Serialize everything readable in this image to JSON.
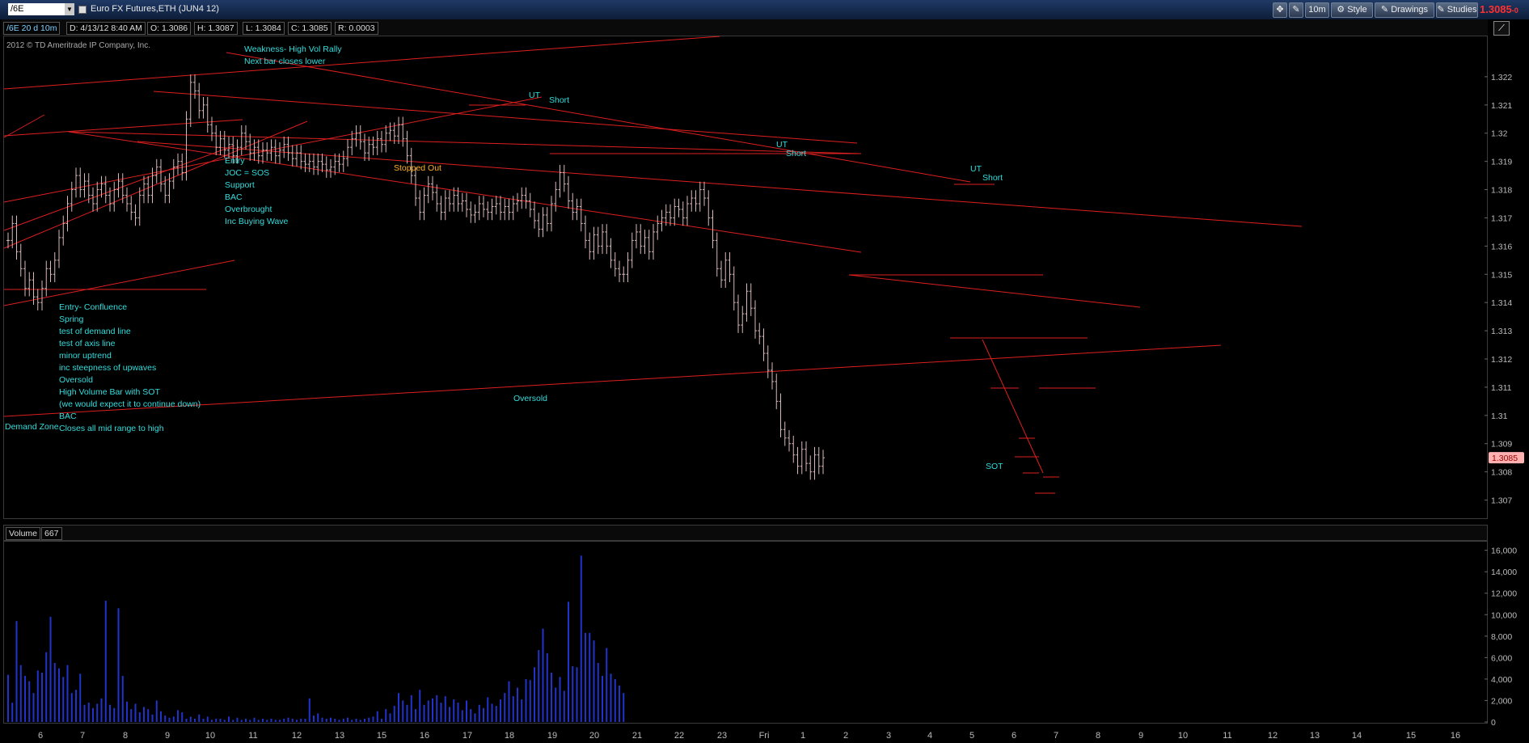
{
  "toolbar": {
    "symbol": "/6E",
    "instrument": "Euro FX Futures,ETH (JUN4 12)",
    "timeframe": "10m",
    "style_label": "Style",
    "drawings_label": "Drawings",
    "studies_label": "Studies",
    "last_price": "1.3085",
    "last_change": "-0"
  },
  "infobar": {
    "period": "/6E 20 d 10m",
    "date": "D: 4/13/12 8:40 AM",
    "open": "O: 1.3086",
    "high": "H: 1.3087",
    "low": "L: 1.3084",
    "close": "C: 1.3085",
    "range": "R: 0.0003",
    "copyright": "2012 © TD Ameritrade IP Company, Inc."
  },
  "volume_panel": {
    "label": "Volume",
    "value": "667"
  },
  "colors": {
    "background": "#000000",
    "candle": "#d8b8b8",
    "trendline": "#dd1f1f",
    "volume": "#2233cc",
    "annotation": "#33dddd",
    "stopped_out": "#ffb020",
    "last_price_box": "#ffb0b0"
  },
  "chart_data": [
    {
      "type": "candlestick",
      "title": "",
      "ylim": [
        1.3065,
        1.323
      ],
      "y_ticks": [
        "1.322",
        "1.321",
        "1.32",
        "1.319",
        "1.318",
        "1.317",
        "1.316",
        "1.315",
        "1.314",
        "1.313",
        "1.312",
        "1.311",
        "1.31",
        "1.309",
        "1.308",
        "1.307"
      ],
      "x_ticks": [
        "6",
        "7",
        "8",
        "9",
        "10",
        "11",
        "12",
        "13",
        "15",
        "16",
        "17",
        "18",
        "19",
        "20",
        "21",
        "22",
        "23",
        "Fri",
        "1",
        "2",
        "3",
        "4",
        "5",
        "6",
        "7",
        "8",
        "9",
        "10",
        "11",
        "12",
        "13",
        "14",
        "15",
        "16"
      ],
      "last_price_label": "1.3085",
      "closes": [
        1.3162,
        1.3168,
        1.3158,
        1.3152,
        1.3145,
        1.3148,
        1.3142,
        1.314,
        1.3145,
        1.3152,
        1.315,
        1.3155,
        1.3163,
        1.3168,
        1.3175,
        1.318,
        1.3185,
        1.318,
        1.3183,
        1.3178,
        1.3175,
        1.318,
        1.3182,
        1.3178,
        1.3175,
        1.318,
        1.3183,
        1.3178,
        1.3175,
        1.3172,
        1.317,
        1.3178,
        1.3182,
        1.3178,
        1.3185,
        1.3188,
        1.3182,
        1.3178,
        1.3183,
        1.3188,
        1.319,
        1.3186,
        1.3205,
        1.3218,
        1.3215,
        1.3208,
        1.321,
        1.3203,
        1.32,
        1.3195,
        1.3198,
        1.3194,
        1.3196,
        1.3192,
        1.3195,
        1.32,
        1.3197,
        1.3193,
        1.3195,
        1.3192,
        1.3194,
        1.3193,
        1.3195,
        1.3192,
        1.3194,
        1.3196,
        1.3193,
        1.3191,
        1.3193,
        1.319,
        1.3189,
        1.319,
        1.3188,
        1.319,
        1.3189,
        1.3187,
        1.3188,
        1.319,
        1.3189,
        1.3191,
        1.3195,
        1.3198,
        1.32,
        1.3197,
        1.3193,
        1.3196,
        1.3195,
        1.3198,
        1.3196,
        1.32,
        1.3201,
        1.3199,
        1.3203,
        1.3198,
        1.3192,
        1.3185,
        1.3177,
        1.3172,
        1.3178,
        1.3182,
        1.3179,
        1.3175,
        1.3172,
        1.3177,
        1.3175,
        1.3178,
        1.3175,
        1.3176,
        1.3173,
        1.3171,
        1.3172,
        1.3175,
        1.3173,
        1.3172,
        1.3174,
        1.3175,
        1.3172,
        1.3174,
        1.3172,
        1.3175,
        1.3176,
        1.3178,
        1.3176,
        1.3173,
        1.3169,
        1.3166,
        1.3171,
        1.3168,
        1.3175,
        1.318,
        1.3186,
        1.3182,
        1.3176,
        1.3172,
        1.3174,
        1.3168,
        1.3162,
        1.3158,
        1.3164,
        1.316,
        1.3165,
        1.316,
        1.3155,
        1.3152,
        1.315,
        1.315,
        1.3155,
        1.3162,
        1.3165,
        1.316,
        1.3163,
        1.3158,
        1.3165,
        1.3168,
        1.317,
        1.3172,
        1.317,
        1.3174,
        1.3173,
        1.317,
        1.3175,
        1.3177,
        1.3175,
        1.318,
        1.3177,
        1.317,
        1.3162,
        1.3152,
        1.3148,
        1.3155,
        1.315,
        1.314,
        1.3132,
        1.3136,
        1.3144,
        1.3138,
        1.313,
        1.3128,
        1.3122,
        1.3116,
        1.3112,
        1.3105,
        1.3095,
        1.3092,
        1.309,
        1.3086,
        1.3082,
        1.3088,
        1.3083,
        1.308,
        1.3086,
        1.3082,
        1.3085
      ]
    },
    {
      "type": "bar",
      "title": "Volume",
      "ylim": [
        0,
        16500
      ],
      "y_ticks": [
        "16,000",
        "14,000",
        "12,000",
        "10,000",
        "8,000",
        "6,000",
        "4,000",
        "2,000",
        "0"
      ],
      "values": [
        4400,
        1800,
        9400,
        5300,
        4300,
        3800,
        2700,
        4800,
        4600,
        6500,
        9800,
        5500,
        5000,
        4200,
        5300,
        2700,
        3000,
        4500,
        1600,
        1800,
        1300,
        1700,
        2200,
        11300,
        1600,
        1300,
        10600,
        4300,
        1900,
        1200,
        1700,
        900,
        1400,
        1200,
        700,
        2000,
        1000,
        600,
        400,
        500,
        1100,
        900,
        300,
        500,
        300,
        700,
        300,
        500,
        200,
        300,
        300,
        200,
        500,
        200,
        400,
        200,
        300,
        200,
        400,
        200,
        300,
        200,
        300,
        200,
        200,
        300,
        400,
        300,
        200,
        300,
        300,
        2200,
        600,
        800,
        400,
        300,
        400,
        300,
        200,
        300,
        400,
        200,
        300,
        200,
        300,
        400,
        500,
        1000,
        300,
        1200,
        800,
        1500,
        2700,
        2000,
        1600,
        2500,
        1200,
        3000,
        1600,
        2000,
        2200,
        2500,
        1800,
        2400,
        1400,
        2100,
        1800,
        1100,
        2000,
        1200,
        800,
        1600,
        1300,
        2300,
        1700,
        1500,
        2100,
        2700,
        3800,
        2400,
        3200,
        2100,
        4000,
        3900,
        5100,
        6700,
        8700,
        6400,
        4600,
        3200,
        4200,
        2900,
        11200,
        5200,
        5100,
        15500,
        8300,
        8300,
        7600,
        5500,
        4300,
        6900,
        4500,
        4000,
        3400,
        2700
      ]
    }
  ],
  "annotations": [
    {
      "id": "weakness",
      "lines": [
        "Weakness- High Vol Rally",
        "Next bar closes lower"
      ]
    },
    {
      "id": "entry-joc",
      "lines": [
        "Entry",
        "JOC = SOS",
        "Support",
        "BAC",
        "Overbrought",
        "Inc Buying Wave"
      ]
    },
    {
      "id": "entry-confluence",
      "lines": [
        "Entry- Confluence",
        "Spring",
        "test of demand line",
        "test of axis line",
        "minor uptrend",
        "inc steepness of upwaves",
        "Oversold",
        "High Volume Bar with SOT",
        "(we would expect it to continue down)",
        "BAC",
        "Closes all mid range to high"
      ]
    },
    {
      "id": "demand-zone",
      "lines": [
        "Demand Zone"
      ]
    },
    {
      "id": "stopped-out",
      "lines": [
        "Stopped Out"
      ]
    },
    {
      "id": "ut1",
      "lines": [
        "UT"
      ]
    },
    {
      "id": "short1",
      "lines": [
        "Short"
      ]
    },
    {
      "id": "ut2",
      "lines": [
        "UT"
      ]
    },
    {
      "id": "short2",
      "lines": [
        "Short"
      ]
    },
    {
      "id": "ut3",
      "lines": [
        "UT"
      ]
    },
    {
      "id": "short3",
      "lines": [
        "Short"
      ]
    },
    {
      "id": "oversold",
      "lines": [
        "Oversold"
      ]
    },
    {
      "id": "sot",
      "lines": [
        "SOT"
      ]
    }
  ]
}
